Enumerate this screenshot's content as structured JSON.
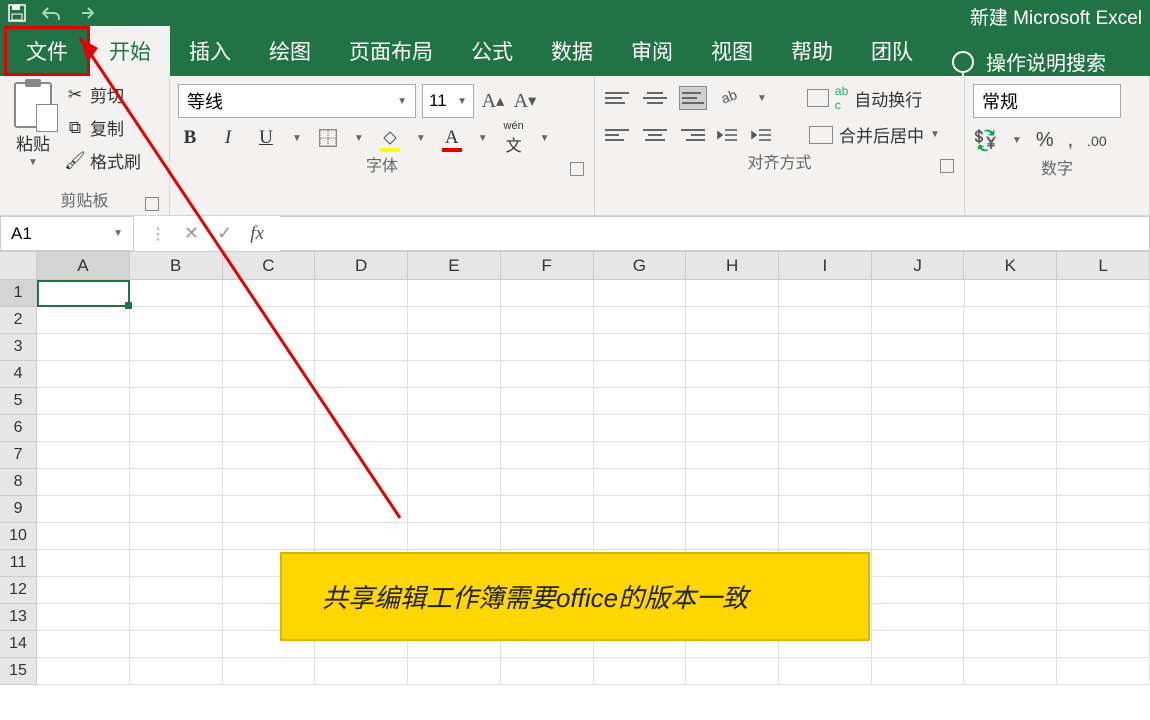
{
  "app_title": "新建 Microsoft Excel",
  "tabs": {
    "file": "文件",
    "home": "开始",
    "insert": "插入",
    "draw": "绘图",
    "layout": "页面布局",
    "formulas": "公式",
    "data": "数据",
    "review": "审阅",
    "view": "视图",
    "help": "帮助",
    "team": "团队",
    "search_hint": "操作说明搜索"
  },
  "ribbon": {
    "clipboard": {
      "paste": "粘贴",
      "cut": "剪切",
      "copy": "复制",
      "format_painter": "格式刷",
      "group_label": "剪贴板"
    },
    "font": {
      "font_name": "等线",
      "font_size": "11",
      "group_label": "字体",
      "wen_label": "wén"
    },
    "alignment": {
      "wrap": "自动换行",
      "merge": "合并后居中",
      "group_label": "对齐方式"
    },
    "number": {
      "format": "常规",
      "group_label": "数字"
    }
  },
  "name_box": "A1",
  "columns": [
    "A",
    "B",
    "C",
    "D",
    "E",
    "F",
    "G",
    "H",
    "I",
    "J",
    "K",
    "L"
  ],
  "rows": [
    1,
    2,
    3,
    4,
    5,
    6,
    7,
    8,
    9,
    10,
    11,
    12,
    13,
    14,
    15
  ],
  "selected_cell": "A1",
  "annotation_text": "共享编辑工作簿需要office的版本一致"
}
